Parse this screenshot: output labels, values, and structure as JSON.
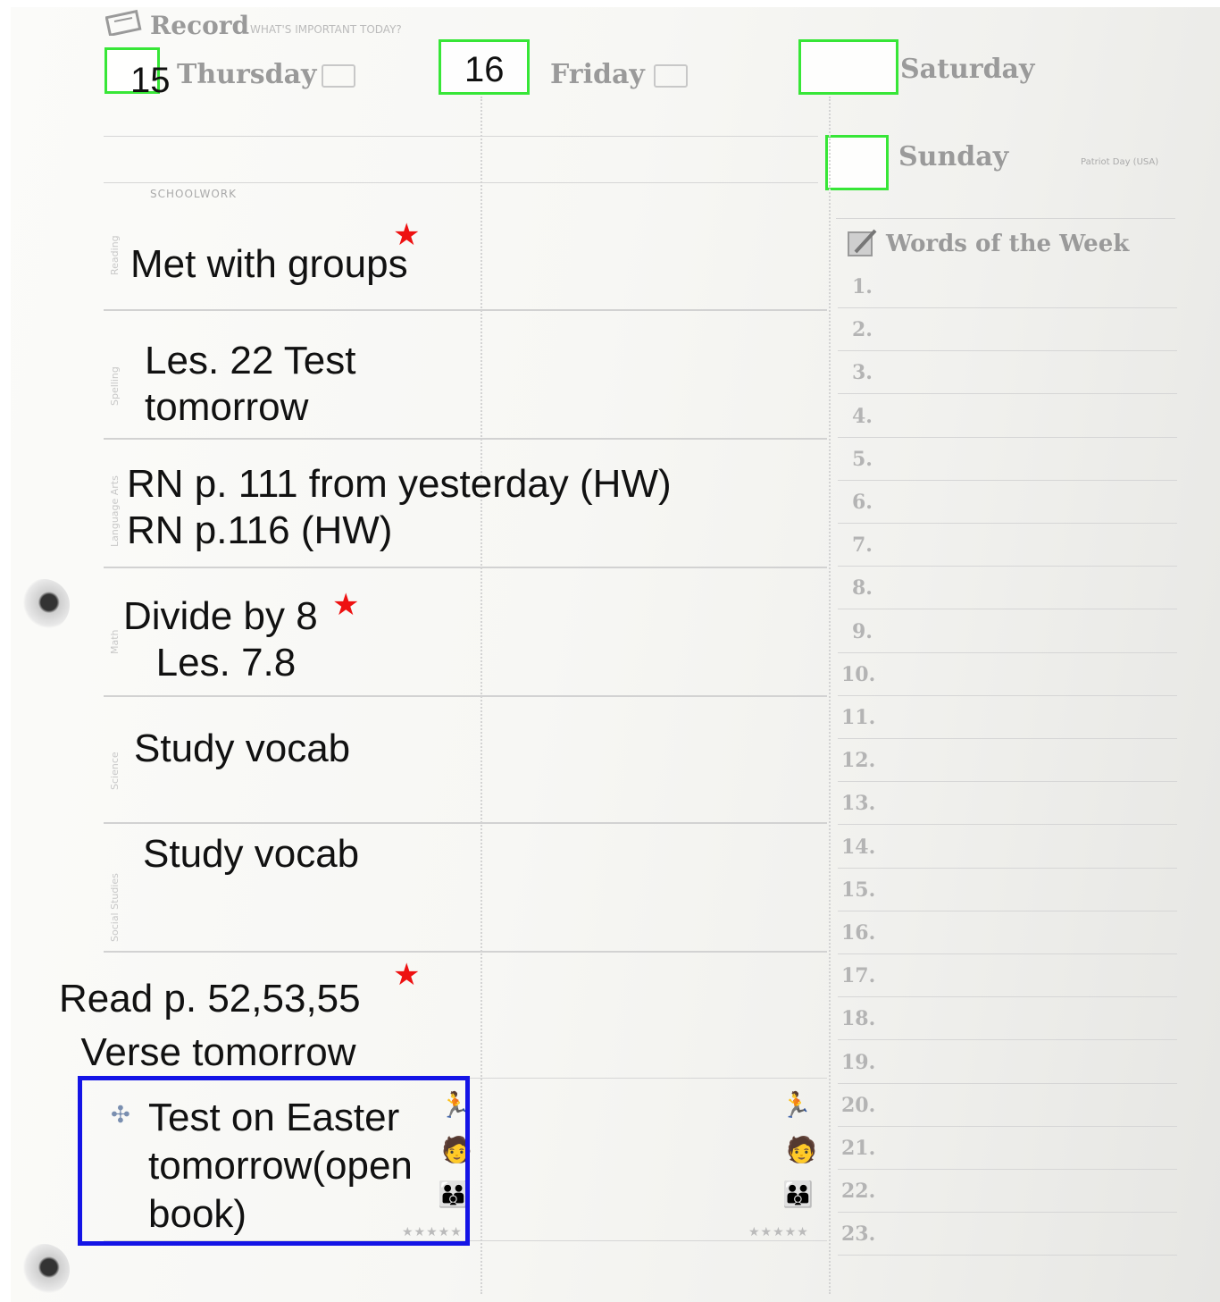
{
  "header": {
    "record_title": "Record",
    "record_subtitle": "WHAT'S IMPORTANT TODAY?",
    "days": [
      {
        "name": "Thursday",
        "date": "15"
      },
      {
        "name": "Friday",
        "date": "16"
      },
      {
        "name": "Saturday",
        "date": ""
      },
      {
        "name": "Sunday",
        "date": ""
      }
    ],
    "sunday_note": "Patriot Day (USA)"
  },
  "section_label": "SCHOOLWORK",
  "subjects": [
    "Reading",
    "Spelling",
    "Language Arts",
    "Math",
    "Science",
    "Social Studies"
  ],
  "entries": {
    "reading": "Met with groups",
    "spelling": "Les. 22 Test\ntomorrow",
    "language_arts": "RN p. 111 from yesterday (HW)\nRN p.116 (HW)",
    "math": "Divide by 8\n   Les. 7.8",
    "science": "Study vocab",
    "social_studies": "Study vocab",
    "bottom": "Read p. 52,53,55\n  Verse tomorrow",
    "boxed": "Test on Easter\ntomorrow(open\nbook)"
  },
  "words_of_week": {
    "title": "Words of the Week",
    "numbers": [
      "1.",
      "2.",
      "3.",
      "4.",
      "5.",
      "6.",
      "7.",
      "8.",
      "9.",
      "10.",
      "11.",
      "12.",
      "13.",
      "14.",
      "15.",
      "16.",
      "17.",
      "18.",
      "19.",
      "20.",
      "21.",
      "22.",
      "23."
    ]
  },
  "colors": {
    "highlight_box": "#37e637",
    "focus_box": "#1414e6",
    "star": "#ee1111",
    "ink": "#111111"
  },
  "icons": [
    "notebook-icon",
    "pencil-icon",
    "star-icon",
    "binder-ring-icon",
    "runner-icon",
    "person-icon",
    "family-icon"
  ]
}
